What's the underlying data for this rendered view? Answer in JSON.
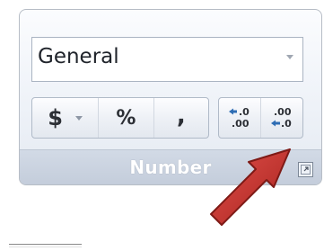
{
  "number_group": {
    "format_select": {
      "value": "General"
    },
    "buttons": {
      "currency": "$",
      "percent": "%",
      "comma": ","
    },
    "label": "Number"
  },
  "icons": {
    "currency": "currency-icon",
    "percent": "percent-icon",
    "comma": "comma-style-icon",
    "increase_decimal": "increase-decimal-icon",
    "decrease_decimal": "decrease-decimal-icon",
    "launcher": "dialog-launcher-icon",
    "pointer": "red-arrow-icon"
  },
  "colors": {
    "arrow_red": "#c8322d",
    "group_bg": "#eef2f8",
    "label_bar": "#c8d1de",
    "accent_blue": "#2e6db4"
  }
}
